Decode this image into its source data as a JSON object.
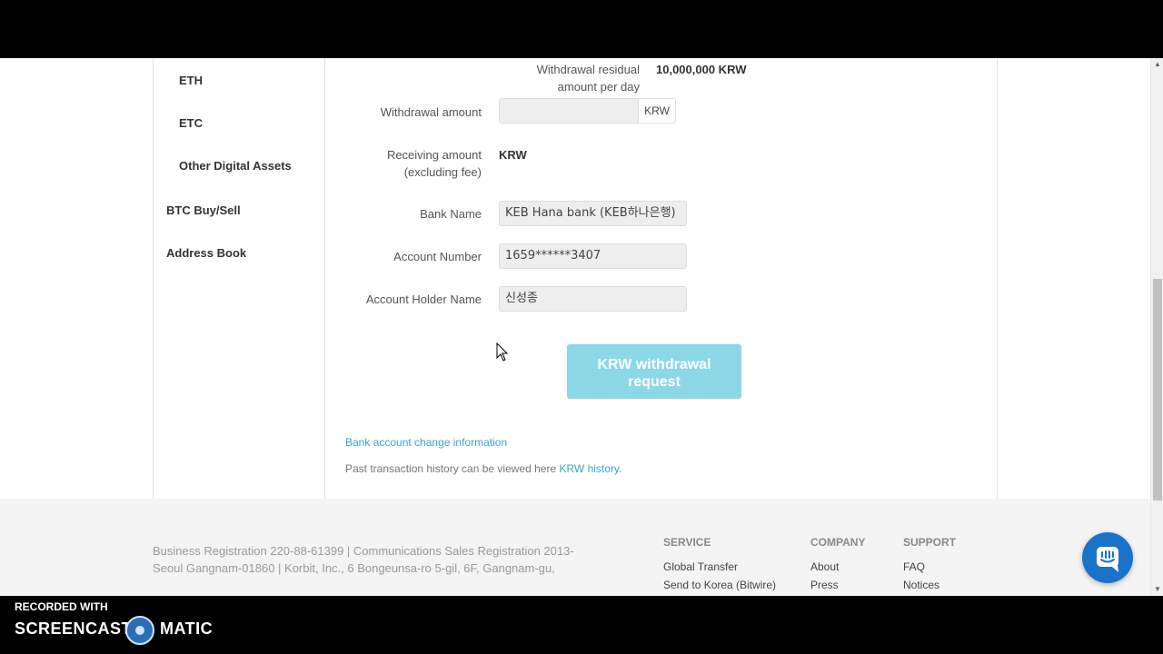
{
  "sidebar": {
    "items": [
      {
        "label": "ETH"
      },
      {
        "label": "ETC"
      },
      {
        "label": "Other Digital Assets"
      },
      {
        "label": "BTC Buy/Sell"
      },
      {
        "label": "Address Book"
      }
    ]
  },
  "form": {
    "residual_label_line1": "Withdrawal residual",
    "residual_label_line2": "amount per day",
    "residual_value": "10,000,000 KRW",
    "amount_label": "Withdrawal amount",
    "amount_value": "",
    "amount_unit": "KRW",
    "receiving_label_line1": "Receiving amount",
    "receiving_label_line2": "(excluding fee)",
    "receiving_value": "KRW",
    "bank_label": "Bank Name",
    "bank_value": "KEB Hana bank (KEB하나은행)",
    "account_label": "Account Number",
    "account_value": "1659******3407",
    "holder_label": "Account Holder Name",
    "holder_value": "신성종",
    "submit_line1": "KRW withdrawal",
    "submit_line2": "request",
    "change_link": "Bank account change information",
    "history_note": "Past transaction history can be viewed here ",
    "history_link": "KRW history."
  },
  "footer": {
    "biz_info": "Business Registration 220-88-61399  |  Communications Sales Registration 2013-Seoul Gangnam-01860  |  Korbit, Inc., 6 Bongeunsa-ro 5-gil, 6F, Gangnam-gu,",
    "columns": [
      {
        "heading": "SERVICE",
        "items": [
          "Global Transfer",
          "Send to Korea (Bitwire)"
        ]
      },
      {
        "heading": "COMPANY",
        "items": [
          "About",
          "Press"
        ]
      },
      {
        "heading": "SUPPORT",
        "items": [
          "FAQ",
          "Notices"
        ]
      }
    ]
  },
  "watermark": {
    "recorded_with": "RECORDED WITH",
    "brand_left": "SCREENCAST",
    "brand_right": "MATIC"
  },
  "colors": {
    "accent": "#8dd8e6",
    "link": "#3aa7c9",
    "chat": "#1a73c8"
  },
  "icons": {
    "chat": "chat-bubble-icon",
    "cursor": "mouse-pointer-icon",
    "scroll_up": "chevron-up-icon",
    "scroll_down": "chevron-down-icon"
  }
}
